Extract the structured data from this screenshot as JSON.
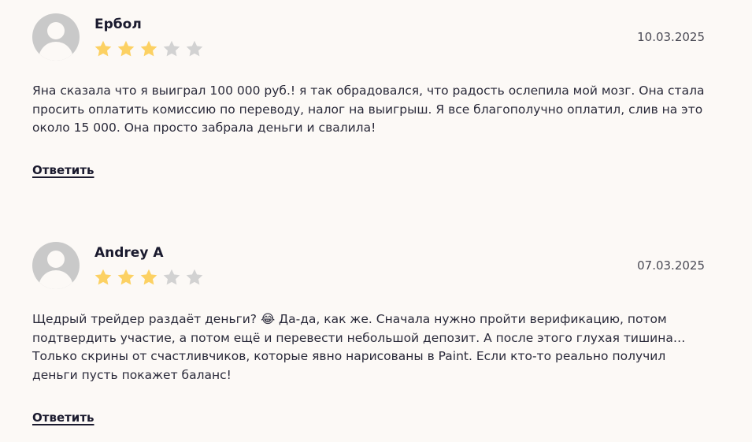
{
  "colors": {
    "star_filled": "#fcd163",
    "star_empty": "#d2d2d2",
    "background": "#fcf9f6",
    "avatar": "#c9c9c9"
  },
  "reviews": [
    {
      "author": "Ербол",
      "date": "10.03.2025",
      "rating": 3,
      "max_rating": 5,
      "text": "Яна сказала что я выиграл 100 000 руб.! я так обрадовался, что радость ослепила мой мозг. Она стала просить оплатить комиссию по переводу, налог на выигрыш. Я все благополучно оплатил, слив на это около 15 000. Она просто забрала деньги и свалила!",
      "reply_label": "Ответить"
    },
    {
      "author": "Andrey A",
      "date": "07.03.2025",
      "rating": 3,
      "max_rating": 5,
      "text": "Щедрый трейдер раздаёт деньги? 😂 Да-да, как же. Сначала нужно пройти верификацию, потом подтвердить участие, а потом ещё и перевести небольшой депозит. А после этого глухая тишина… Только скрины от счастливчиков, которые явно нарисованы в Paint. Если кто-то реально получил деньги пусть покажет баланс!",
      "reply_label": "Ответить"
    }
  ]
}
